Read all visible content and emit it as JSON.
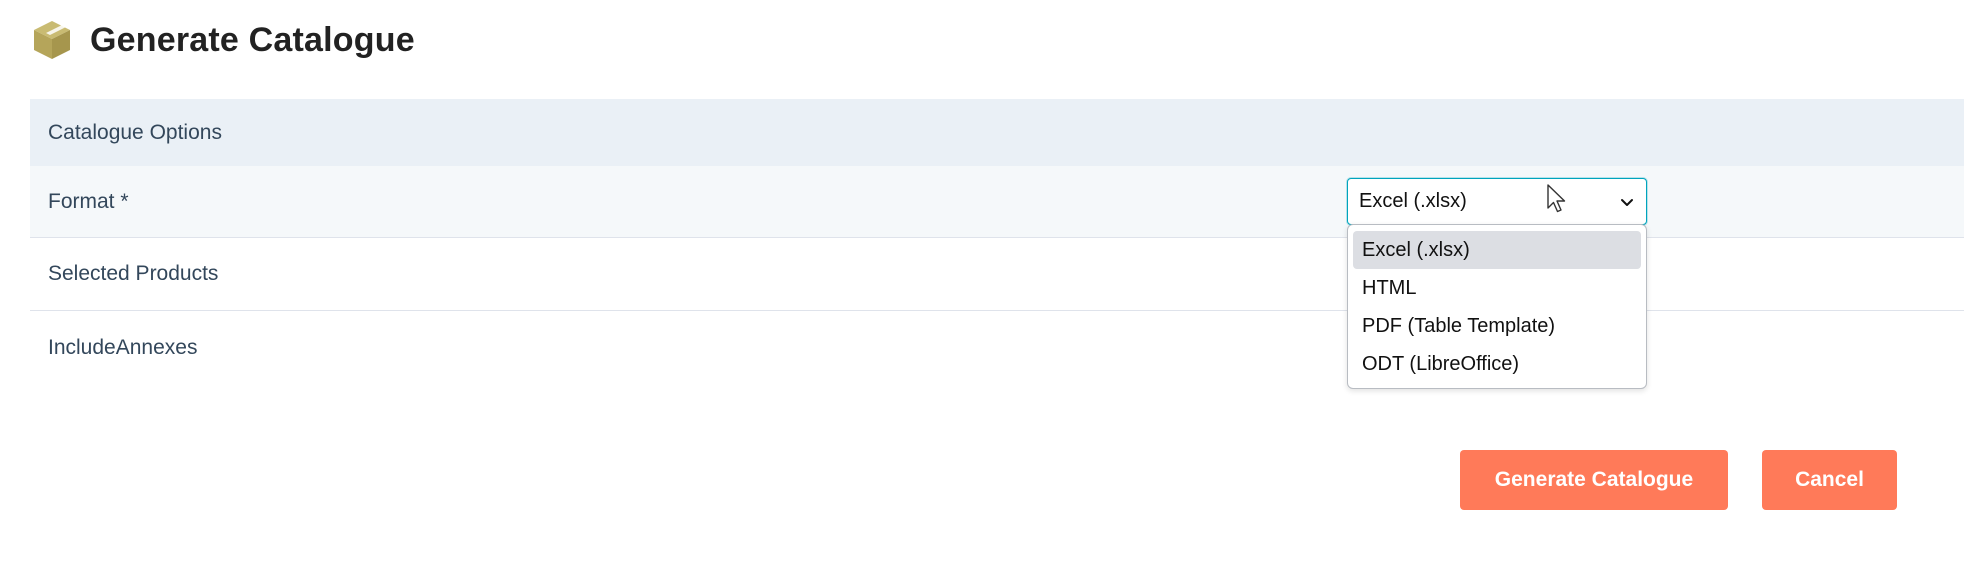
{
  "header": {
    "icon": "box-icon",
    "title": "Generate Catalogue"
  },
  "section": {
    "title": "Catalogue Options"
  },
  "fields": {
    "format_label": "Format *",
    "selected_products_label": "Selected Products",
    "include_annexes_label": "IncludeAnnexes"
  },
  "format_select": {
    "value": "Excel (.xlsx)",
    "options": [
      "Excel (.xlsx)",
      "HTML",
      "PDF (Table Template)",
      "ODT (LibreOffice)"
    ],
    "highlighted_option": "Excel (.xlsx)",
    "focus_color": "#00a4bd"
  },
  "buttons": {
    "generate": "Generate Catalogue",
    "cancel": "Cancel"
  },
  "colors": {
    "accent": "#ff7a59",
    "icon": "#b5a55a",
    "section_bg": "#eaf0f6",
    "label_text": "#33475b"
  }
}
